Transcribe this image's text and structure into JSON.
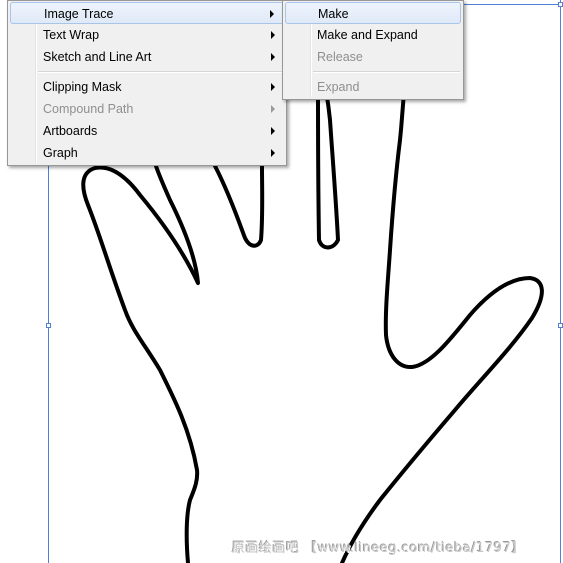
{
  "menu": {
    "items": [
      {
        "label": "Image Trace",
        "has_submenu": true,
        "enabled": true,
        "highlighted": true
      },
      {
        "label": "Text Wrap",
        "has_submenu": true,
        "enabled": true
      },
      {
        "label": "Sketch and Line Art",
        "has_submenu": true,
        "enabled": true
      },
      {
        "label": "Clipping Mask",
        "has_submenu": true,
        "enabled": true
      },
      {
        "label": "Compound Path",
        "has_submenu": true,
        "enabled": false
      },
      {
        "label": "Artboards",
        "has_submenu": true,
        "enabled": true
      },
      {
        "label": "Graph",
        "has_submenu": true,
        "enabled": true
      }
    ]
  },
  "submenu": {
    "parent": "Image Trace",
    "items": [
      {
        "label": "Make",
        "enabled": true,
        "highlighted": true
      },
      {
        "label": "Make and Expand",
        "enabled": true
      },
      {
        "label": "Release",
        "enabled": false
      },
      {
        "label": "Expand",
        "enabled": false
      }
    ]
  },
  "watermark": "原画绘画吧 【www.lineeg.com/tieba/1797】",
  "colors": {
    "selection": "#4f7fd6",
    "menu_background": "#f0f0f0",
    "disabled_text": "#8f8f8f"
  }
}
